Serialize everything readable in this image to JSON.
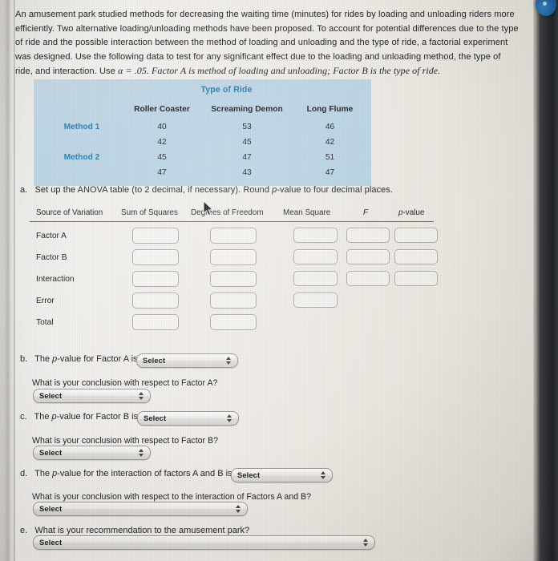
{
  "problem": {
    "paragraph": "An amusement park studied methods for decreasing the waiting time (minutes) for rides by loading and unloading riders more efficiently. Two alternative loading/unloading methods have been proposed. To account for potential differences due to the type of ride and the possible interaction between the method of loading and unloading and the type of ride, a factorial experiment was designed. Use the following data to test for any significant effect due to the loading and unloading method, the type of ride, and interaction. Use",
    "alpha_text": "α = .05. Factor A is method of loading and unloading; Factor B is the type of ride."
  },
  "data_table": {
    "title": "Type of Ride",
    "column_headers": [
      "Roller Coaster",
      "Screaming Demon",
      "Long Flume"
    ],
    "row_groups": [
      {
        "label": "Method 1",
        "rows": [
          [
            "40",
            "53",
            "46"
          ],
          [
            "42",
            "45",
            "42"
          ]
        ]
      },
      {
        "label": "Method 2",
        "rows": [
          [
            "45",
            "47",
            "51"
          ],
          [
            "47",
            "43",
            "47"
          ]
        ]
      }
    ],
    "header_color": "#2b7fb0",
    "background_color": "#bcd5e4"
  },
  "part_a": {
    "marker": "a.",
    "text_before": "Set up the ANOVA table (to 2 decimal, if necessary). Round ",
    "italic": "p",
    "text_after": "-value to four decimal places."
  },
  "anova": {
    "headers": [
      "Source of Variation",
      "Sum of Squares",
      "Degrees of Freedom",
      "Mean Square",
      "F",
      "p-value"
    ],
    "rows": [
      {
        "label": "Factor A",
        "inputs": 5
      },
      {
        "label": "Factor B",
        "inputs": 5
      },
      {
        "label": "Interaction",
        "inputs": 5
      },
      {
        "label": "Error",
        "inputs": 3
      },
      {
        "label": "Total",
        "inputs": 2
      }
    ]
  },
  "select_placeholder": "Select",
  "part_b": {
    "marker": "b.",
    "prompt_before": "The ",
    "prompt_italic": "p",
    "prompt_after": "-value for Factor A is",
    "conclusion_prompt": "What is your conclusion with respect to Factor A?"
  },
  "part_c": {
    "marker": "c.",
    "prompt_before": "The ",
    "prompt_italic": "p",
    "prompt_after": "-value for Factor B is",
    "conclusion_prompt": "What is your conclusion with respect to Factor B?"
  },
  "part_d": {
    "marker": "d.",
    "prompt_before": "The ",
    "prompt_italic": "p",
    "prompt_after": "-value for the interaction of factors A and B is",
    "conclusion_prompt": "What is your conclusion with respect to the interaction of Factors A and B?"
  },
  "part_e": {
    "marker": "e.",
    "prompt": "What is your recommendation to the amusement park?"
  }
}
